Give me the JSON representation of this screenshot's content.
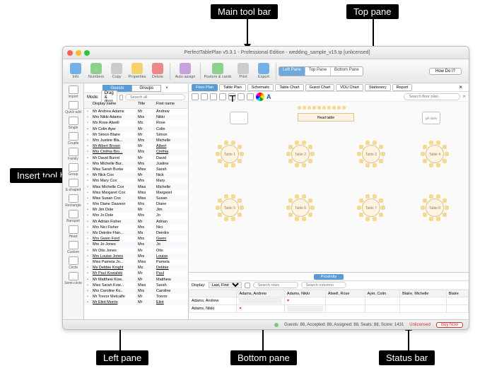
{
  "callouts": {
    "main_toolbar": "Main tool bar",
    "top_pane": "Top pane",
    "insert_toolbar": "Insert tool bar",
    "left_pane": "Left pane",
    "bottom_pane": "Bottom pane",
    "status_bar": "Status bar"
  },
  "window": {
    "title": "PerfectTablePlan v5.3.1 - Professional Edition - wedding_sample_v15.tp [unlicensed]"
  },
  "maintoolbar": {
    "buttons": [
      "Info",
      "Numbers",
      "Copy",
      "Properties",
      "Delete",
      "Auto assign",
      "Posters & cards",
      "Print",
      "Export"
    ],
    "seg": [
      "Left Pane",
      "Top Pane",
      "Bottom Pane"
    ],
    "howdo": "How Do I?"
  },
  "insert_toolbar": [
    "Import",
    "Quick add",
    "Single",
    "Couple",
    "Family",
    "Group",
    "E-shaped",
    "Rectangle",
    "Banquet",
    "Head",
    "Custom",
    "Circle",
    "Semi-circle"
  ],
  "leftpane": {
    "tabs": [
      "Guests",
      "Groups"
    ],
    "mode_label": "Mode:",
    "mode_value": "Drag & drop",
    "search_ph": "Search all",
    "cols": [
      "",
      "Display name",
      "Title",
      "First name"
    ],
    "rows": [
      {
        "g": "m",
        "d": "Mr Andrew Adams",
        "t": "Mr",
        "f": "Andrew",
        "u": 0
      },
      {
        "g": "f",
        "d": "Mrs Nikki Adams",
        "t": "Mrs",
        "f": "Nikki",
        "u": 0
      },
      {
        "g": "f",
        "d": "Ms Rose Atwell",
        "t": "Ms",
        "f": "Rose",
        "u": 0
      },
      {
        "g": "m",
        "d": "Mr Colin Ayer",
        "t": "Mr",
        "f": "Colin",
        "u": 0
      },
      {
        "g": "m",
        "d": "Mr Simon Blaire",
        "t": "Mr",
        "f": "Simon",
        "u": 0
      },
      {
        "g": "f",
        "d": "Mrs Justine Bla...",
        "t": "Mrs",
        "f": "Michelle",
        "u": 0
      },
      {
        "g": "m",
        "d": "Mr Albert Brown",
        "t": "Mr",
        "f": "Albert",
        "u": 1
      },
      {
        "g": "f",
        "d": "Mrs Cinthia Bro...",
        "t": "Mrs",
        "f": "Cinthia",
        "u": 1
      },
      {
        "g": "m",
        "d": "Mr David Burrel",
        "t": "Mr",
        "f": "David",
        "u": 0
      },
      {
        "g": "f",
        "d": "Mrs Michelle Bur..",
        "t": "Mrs",
        "f": "Justine",
        "u": 0
      },
      {
        "g": "f",
        "d": "Miss Sarah Burke",
        "t": "Miss",
        "f": "Sarah",
        "u": 0
      },
      {
        "g": "m",
        "d": "Mr Nick Cox",
        "t": "Mr",
        "f": "Nick",
        "u": 0
      },
      {
        "g": "f",
        "d": "Mrs Mary Cox",
        "t": "Mrs",
        "f": "Mary",
        "u": 0
      },
      {
        "g": "f",
        "d": "Miss Michelle Cox",
        "t": "Miss",
        "f": "Michelle",
        "u": 0
      },
      {
        "g": "f",
        "d": "Miss Margaret Cox",
        "t": "Miss",
        "f": "Margaret",
        "u": 0
      },
      {
        "g": "f",
        "d": "Miss Susan Cox",
        "t": "Miss",
        "f": "Susan",
        "u": 0
      },
      {
        "g": "f",
        "d": "Mrs Diane Dawson",
        "t": "Mrs",
        "f": "Diane",
        "u": 0
      },
      {
        "g": "m",
        "d": "Mr Jim Dole",
        "t": "Mr",
        "f": "Jim",
        "u": 0
      },
      {
        "g": "f",
        "d": "Mrs Jo Dole",
        "t": "Mrs",
        "f": "Jo",
        "u": 0
      },
      {
        "g": "m",
        "d": "Mr Adrian Fisher",
        "t": "Mr",
        "f": "Adrian",
        "u": 0
      },
      {
        "g": "f",
        "d": "Mrs Nici Fisher",
        "t": "Mrs",
        "f": "Nici",
        "u": 0
      },
      {
        "g": "f",
        "d": "Ms Deirdre Flan...",
        "t": "Ms",
        "f": "Deirdre",
        "u": 0
      },
      {
        "g": "f",
        "d": "Mrs Gwen Ford",
        "t": "Mrs",
        "f": "Gwen",
        "u": 1
      },
      {
        "g": "f",
        "d": "Mrs Jo Jones",
        "t": "Mrs",
        "f": "Jo",
        "u": 0
      },
      {
        "g": "m",
        "d": "Mr Otis Jones",
        "t": "Mr",
        "f": "Otis",
        "u": 0
      },
      {
        "g": "f",
        "d": "Mrs Louise Jones",
        "t": "Mrs",
        "f": "Louise",
        "u": 1
      },
      {
        "g": "f",
        "d": "Miss Pamela Jo...",
        "t": "Miss",
        "f": "Pamela",
        "u": 0
      },
      {
        "g": "f",
        "d": "Ms Debbie Knight",
        "t": "Ms",
        "f": "Debbie",
        "u": 1
      },
      {
        "g": "m",
        "d": "Mr Paul Kowalski",
        "t": "Mr",
        "f": "Paul",
        "u": 1
      },
      {
        "g": "m",
        "d": "Mr Matthew Kow..",
        "t": "Mr",
        "f": "Matthew",
        "u": 0
      },
      {
        "g": "f",
        "d": "Miss Sarah Kow...",
        "t": "Miss",
        "f": "Sarah",
        "u": 0
      },
      {
        "g": "f",
        "d": "Mrs Caroline Ko..",
        "t": "Mrs",
        "f": "Caroline",
        "u": 0
      },
      {
        "g": "m",
        "d": "Mr Trevor Metcalfe",
        "t": "Mr",
        "f": "Trevor",
        "u": 0
      },
      {
        "g": "m",
        "d": "Mr Eliot Morris",
        "t": "Mr",
        "f": "Eliot",
        "u": 1
      }
    ]
  },
  "toppane": {
    "tabs": [
      "Floor Plan",
      "Table Plan",
      "Schematic",
      "Table Chart",
      "Guest Chart",
      "VDU Chart",
      "Stationery",
      "Report"
    ],
    "search_ph": "Search floor plan",
    "tables": [
      "Table 1",
      "Table 2",
      "Table 3",
      "Table 4",
      "Table 5",
      "Table 6",
      "Table 7",
      "Table 8"
    ],
    "head": "Head table",
    "gift": "gift table"
  },
  "bottompane": {
    "tab": "Proximity",
    "display_label": "Display:",
    "display_value": "Last, First",
    "search_rows_ph": "Search rows",
    "search_cols_ph": "Search columns",
    "cols": [
      "",
      "Adams, Andrew",
      "Adams, Nikki",
      "Atwell, Rose",
      "Ayer, Colin",
      "Blaire, Michelle",
      "Blaire"
    ],
    "rows": [
      "Adams, Andrew",
      "Adams, Nikki"
    ]
  },
  "statusbar": {
    "text": "Guests: 88, Accepted: 88, Assigned: 88, Seats: 88, Score: 1431",
    "lic": "Unlicensed",
    "buy": "Buy Now"
  }
}
